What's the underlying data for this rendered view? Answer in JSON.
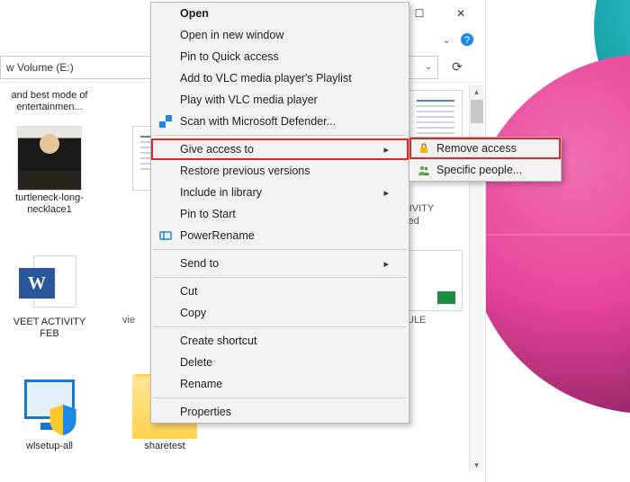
{
  "titlebar": {
    "min": "─",
    "max": "☐",
    "close": "✕"
  },
  "address": {
    "text": "w Volume (E:)",
    "drop": "⌄",
    "refresh": "⟳"
  },
  "items": {
    "a": "and best mode of entertainmen...",
    "b": "turtleneck-long-necklace1",
    "c": "VEET ACTIVITY FEB",
    "d": "wlsetup-all",
    "e": "vie",
    "f": "sharetest",
    "g": "TIVITY",
    "h": "ited",
    "i": "ULE"
  },
  "ctx": {
    "open": "Open",
    "open_new": "Open in new window",
    "pin_qa": "Pin to Quick access",
    "vlc": "Add to VLC media player's Playlist",
    "vlc_play": "Play with VLC media player",
    "defender": "Scan with Microsoft Defender...",
    "give_access": "Give access to",
    "restore": "Restore previous versions",
    "library": "Include in library",
    "pin_start": "Pin to Start",
    "powerrename": "PowerRename",
    "sendto": "Send to",
    "cut": "Cut",
    "copy": "Copy",
    "shortcut": "Create shortcut",
    "delete": "Delete",
    "rename": "Rename",
    "properties": "Properties"
  },
  "submenu": {
    "remove": "Remove access",
    "specific": "Specific people..."
  }
}
